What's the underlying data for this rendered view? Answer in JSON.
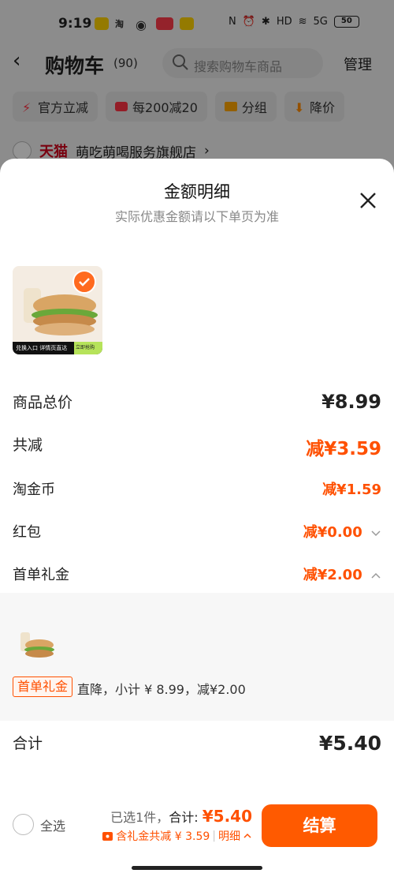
{
  "status_bar": {
    "time": "9:19",
    "network": "5G",
    "battery": "50"
  },
  "header": {
    "title": "购物车",
    "count": "(90)",
    "search_placeholder": "搜索购物车商品",
    "manage_label": "管理"
  },
  "filter_chips": [
    {
      "label": "官方立减",
      "icon": "lightning-icon"
    },
    {
      "label": "每200减20",
      "icon": "coupon-icon"
    },
    {
      "label": "分组",
      "icon": "folder-icon"
    },
    {
      "label": "降价",
      "icon": "arrow-down-icon"
    }
  ],
  "store": {
    "brand": "天猫",
    "name": "萌吃萌喝服务旗舰店"
  },
  "sheet": {
    "title": "金额明细",
    "subtitle": "实际优惠金额请以下单页为准",
    "product_banner_left": "兑换入口 详情页直达",
    "product_banner_right": "立即抢购",
    "rows": {
      "total_label": "商品总价",
      "total_value": "¥8.99",
      "discount_label": "共减",
      "discount_value": "减¥3.59",
      "coins_label": "淘金币",
      "coins_value": "减¥1.59",
      "redpacket_label": "红包",
      "redpacket_value": "减¥0.00",
      "firstorder_label": "首单礼金",
      "firstorder_value": "减¥2.00"
    },
    "detail": {
      "tag": "首单礼金",
      "note": "直降，小计 ¥ 8.99，减¥2.00"
    },
    "sum_label": "合计",
    "sum_value": "¥5.40"
  },
  "bottom_bar": {
    "select_all": "全选",
    "selected_count": "已选1件，",
    "total_label": "合计: ",
    "total_value": "¥5.40",
    "savings": "含礼金共减 ¥ 3.59",
    "detail_link": "明细",
    "checkout": "结算"
  },
  "colors": {
    "accent": "#ff5000",
    "checkout_bg": "#ff5a00",
    "tmall_red": "#d1001a"
  }
}
